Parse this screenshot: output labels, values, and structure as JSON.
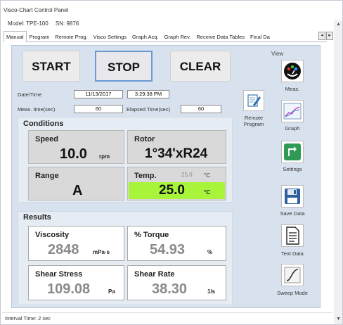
{
  "window": {
    "title": "Visco-Chart Control Panel"
  },
  "device": {
    "model_label": "Model: TPE-100",
    "sn_label": "SN: 9876"
  },
  "tabs": [
    "Manual",
    "Program",
    "Remote Prog.",
    "Visco Settings",
    "Graph Acq.",
    "Graph Rev.",
    "Receive Data Tables",
    "Final Da"
  ],
  "active_tab": "Manual",
  "controls": {
    "start": "START",
    "stop": "STOP",
    "clear": "CLEAR"
  },
  "info": {
    "datetime_label": "Date/Time",
    "date": "11/13/2017",
    "time": "3:29:38 PM",
    "meas_time_label": "Meas. time(sec)",
    "meas_time": "60",
    "elapsed_label": "Elapsed Time(sec)",
    "elapsed": "60"
  },
  "conditions": {
    "title": "Conditions",
    "speed_label": "Speed",
    "speed_value": "10.0",
    "speed_unit": "rpm",
    "rotor_label": "Rotor",
    "rotor_value": "1°34'xR24",
    "range_label": "Range",
    "range_value": "A",
    "temp_label": "Temp.",
    "temp_set": "25.0",
    "temp_set_unit": "°C",
    "temp_value": "25.0",
    "temp_unit": "°C",
    "temp_highlight_color": "#a8f43a"
  },
  "results": {
    "title": "Results",
    "viscosity_label": "Viscosity",
    "viscosity_value": "2848",
    "viscosity_unit": "mPa·s",
    "torque_label": "% Torque",
    "torque_value": "54.93",
    "torque_unit": "%",
    "shear_stress_label": "Shear Stress",
    "shear_stress_value": "109.08",
    "shear_stress_unit": "Pa",
    "shear_rate_label": "Shear Rate",
    "shear_rate_value": "38.30",
    "shear_rate_unit": "1/s"
  },
  "remote": {
    "label_line1": "Remote",
    "label_line2": "Program",
    "icon": "pencil-notepad-icon"
  },
  "view": {
    "title": "View",
    "items": [
      {
        "label": "Meas.",
        "icon": "gauge-icon"
      },
      {
        "label": "Graph",
        "icon": "graph-icon"
      },
      {
        "label": "Settings",
        "icon": "wrench-icon"
      },
      {
        "label": "Save Data",
        "icon": "floppy-disk-icon"
      },
      {
        "label": "Text Data",
        "icon": "document-icon"
      },
      {
        "label": "Sweep Mode",
        "icon": "sweep-curve-icon"
      }
    ]
  },
  "status": {
    "text": "Interval Time: 2 sec"
  }
}
